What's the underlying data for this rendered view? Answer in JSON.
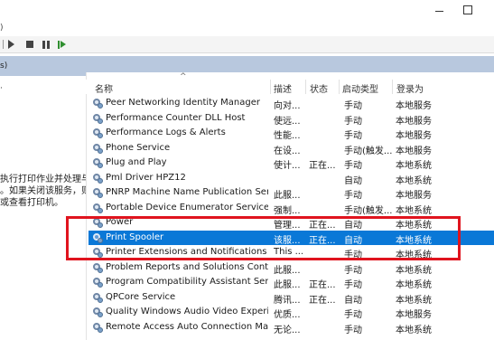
{
  "window": {
    "minimize_icon": "minimize-icon",
    "maximize_icon": "maximize-icon"
  },
  "fragments": {
    "top_left": ")",
    "tree_left": "s)",
    "side_dot": "·"
  },
  "toolbar": {
    "buttons": [
      {
        "name": "start-service-button",
        "icon": "play-icon"
      },
      {
        "name": "stop-service-button",
        "icon": "stop-icon"
      },
      {
        "name": "pause-service-button",
        "icon": "pause-icon"
      },
      {
        "name": "restart-service-button",
        "icon": "restart-icon"
      }
    ]
  },
  "description_panel": {
    "lines": [
      "执行打印作业并处理与",
      "。如果关闭该服务，则",
      "或查看打印机。"
    ]
  },
  "table": {
    "sort_indicator": "^",
    "columns": [
      "名称",
      "描述",
      "状态",
      "启动类型",
      "登录为"
    ],
    "rows": [
      {
        "name": "Peer Networking Identity Manager",
        "desc": "向对...",
        "status": "",
        "start": "手动",
        "logon": "本地服务"
      },
      {
        "name": "Performance Counter DLL Host",
        "desc": "使远...",
        "status": "",
        "start": "手动",
        "logon": "本地服务"
      },
      {
        "name": "Performance Logs & Alerts",
        "desc": "性能...",
        "status": "",
        "start": "手动",
        "logon": "本地服务"
      },
      {
        "name": "Phone Service",
        "desc": "在设...",
        "status": "",
        "start": "手动(触发...",
        "logon": "本地服务"
      },
      {
        "name": "Plug and Play",
        "desc": "使计...",
        "status": "正在...",
        "start": "手动",
        "logon": "本地系统"
      },
      {
        "name": "Pml Driver HPZ12",
        "desc": "",
        "status": "",
        "start": "自动",
        "logon": "本地系统"
      },
      {
        "name": "PNRP Machine Name Publication Serv...",
        "desc": "此服...",
        "status": "",
        "start": "手动",
        "logon": "本地服务"
      },
      {
        "name": "Portable Device Enumerator Service",
        "desc": "强制...",
        "status": "",
        "start": "手动(触发...",
        "logon": "本地系统"
      },
      {
        "name": "Power",
        "desc": "管理...",
        "status": "正在...",
        "start": "自动",
        "logon": "本地系统"
      },
      {
        "name": "Print Spooler",
        "desc": "该服...",
        "status": "正在...",
        "start": "自动",
        "logon": "本地系统",
        "selected": true
      },
      {
        "name": "Printer Extensions and Notifications",
        "desc": "This ...",
        "status": "",
        "start": "手动",
        "logon": "本地系统"
      },
      {
        "name": "Problem Reports and Solutions Contr...",
        "desc": "此服...",
        "status": "",
        "start": "手动",
        "logon": "本地系统"
      },
      {
        "name": "Program Compatibility Assistant Servi...",
        "desc": "此服...",
        "status": "正在...",
        "start": "手动",
        "logon": "本地系统"
      },
      {
        "name": "QPCore Service",
        "desc": "腾讯...",
        "status": "正在...",
        "start": "自动",
        "logon": "本地系统"
      },
      {
        "name": "Quality Windows Audio Video Experie...",
        "desc": "优质...",
        "status": "",
        "start": "手动",
        "logon": "本地服务"
      },
      {
        "name": "Remote Access Auto Connection Man...",
        "desc": "无论...",
        "status": "",
        "start": "手动",
        "logon": "本地系统"
      }
    ]
  },
  "highlight": {
    "color": "#e0141e"
  },
  "selection_color": "#0a78d7"
}
